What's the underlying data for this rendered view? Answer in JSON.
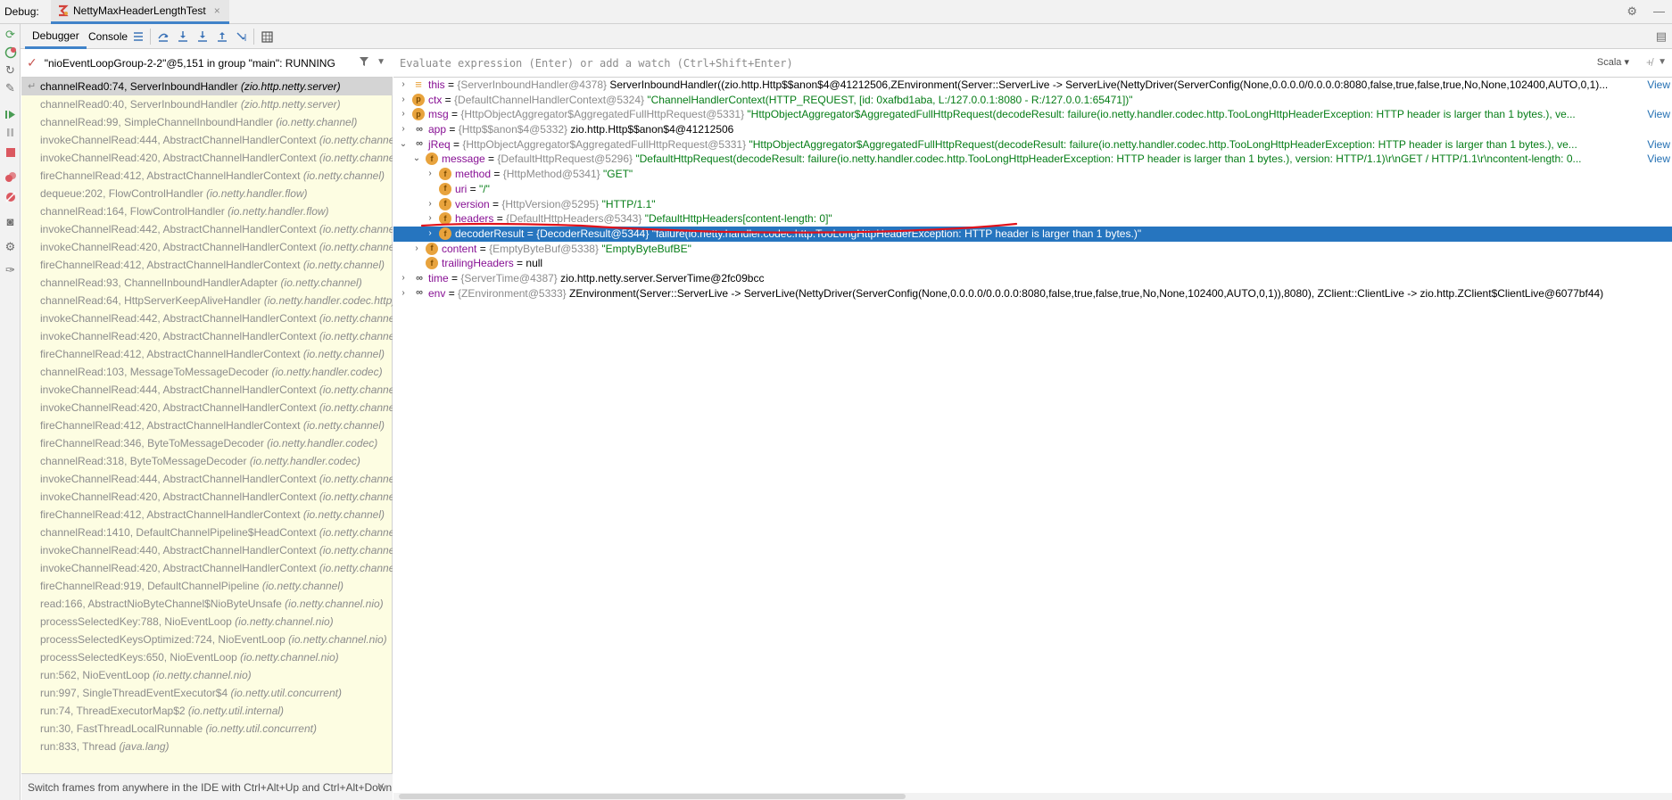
{
  "titlebar": {
    "debug_label": "Debug:",
    "session_tab": "NettyMaxHeaderLengthTest",
    "close": "×"
  },
  "toolbar": {
    "tabs": [
      {
        "label": "Debugger",
        "active": true
      },
      {
        "label": "Console",
        "active": false
      }
    ]
  },
  "thread": {
    "label": "\"nioEventLoopGroup-2-2\"@5,151 in group \"main\": RUNNING"
  },
  "frames": [
    {
      "method": "channelRead0:74, ServerInboundHandler",
      "pkg": "(zio.http.netty.server)",
      "current": true
    },
    {
      "method": "channelRead0:40, ServerInboundHandler",
      "pkg": "(zio.http.netty.server)"
    },
    {
      "method": "channelRead:99, SimpleChannelInboundHandler",
      "pkg": "(io.netty.channel)"
    },
    {
      "method": "invokeChannelRead:444, AbstractChannelHandlerContext",
      "pkg": "(io.netty.channel)"
    },
    {
      "method": "invokeChannelRead:420, AbstractChannelHandlerContext",
      "pkg": "(io.netty.channel)"
    },
    {
      "method": "fireChannelRead:412, AbstractChannelHandlerContext",
      "pkg": "(io.netty.channel)"
    },
    {
      "method": "dequeue:202, FlowControlHandler",
      "pkg": "(io.netty.handler.flow)"
    },
    {
      "method": "channelRead:164, FlowControlHandler",
      "pkg": "(io.netty.handler.flow)"
    },
    {
      "method": "invokeChannelRead:442, AbstractChannelHandlerContext",
      "pkg": "(io.netty.channel)"
    },
    {
      "method": "invokeChannelRead:420, AbstractChannelHandlerContext",
      "pkg": "(io.netty.channel)"
    },
    {
      "method": "fireChannelRead:412, AbstractChannelHandlerContext",
      "pkg": "(io.netty.channel)"
    },
    {
      "method": "channelRead:93, ChannelInboundHandlerAdapter",
      "pkg": "(io.netty.channel)"
    },
    {
      "method": "channelRead:64, HttpServerKeepAliveHandler",
      "pkg": "(io.netty.handler.codec.http)"
    },
    {
      "method": "invokeChannelRead:442, AbstractChannelHandlerContext",
      "pkg": "(io.netty.channel)"
    },
    {
      "method": "invokeChannelRead:420, AbstractChannelHandlerContext",
      "pkg": "(io.netty.channel)"
    },
    {
      "method": "fireChannelRead:412, AbstractChannelHandlerContext",
      "pkg": "(io.netty.channel)"
    },
    {
      "method": "channelRead:103, MessageToMessageDecoder",
      "pkg": "(io.netty.handler.codec)"
    },
    {
      "method": "invokeChannelRead:444, AbstractChannelHandlerContext",
      "pkg": "(io.netty.channel)"
    },
    {
      "method": "invokeChannelRead:420, AbstractChannelHandlerContext",
      "pkg": "(io.netty.channel)"
    },
    {
      "method": "fireChannelRead:412, AbstractChannelHandlerContext",
      "pkg": "(io.netty.channel)"
    },
    {
      "method": "fireChannelRead:346, ByteToMessageDecoder",
      "pkg": "(io.netty.handler.codec)"
    },
    {
      "method": "channelRead:318, ByteToMessageDecoder",
      "pkg": "(io.netty.handler.codec)"
    },
    {
      "method": "invokeChannelRead:444, AbstractChannelHandlerContext",
      "pkg": "(io.netty.channel)"
    },
    {
      "method": "invokeChannelRead:420, AbstractChannelHandlerContext",
      "pkg": "(io.netty.channel)"
    },
    {
      "method": "fireChannelRead:412, AbstractChannelHandlerContext",
      "pkg": "(io.netty.channel)"
    },
    {
      "method": "channelRead:1410, DefaultChannelPipeline$HeadContext",
      "pkg": "(io.netty.channel)"
    },
    {
      "method": "invokeChannelRead:440, AbstractChannelHandlerContext",
      "pkg": "(io.netty.channel)"
    },
    {
      "method": "invokeChannelRead:420, AbstractChannelHandlerContext",
      "pkg": "(io.netty.channel)"
    },
    {
      "method": "fireChannelRead:919, DefaultChannelPipeline",
      "pkg": "(io.netty.channel)"
    },
    {
      "method": "read:166, AbstractNioByteChannel$NioByteUnsafe",
      "pkg": "(io.netty.channel.nio)"
    },
    {
      "method": "processSelectedKey:788, NioEventLoop",
      "pkg": "(io.netty.channel.nio)"
    },
    {
      "method": "processSelectedKeysOptimized:724, NioEventLoop",
      "pkg": "(io.netty.channel.nio)"
    },
    {
      "method": "processSelectedKeys:650, NioEventLoop",
      "pkg": "(io.netty.channel.nio)"
    },
    {
      "method": "run:562, NioEventLoop",
      "pkg": "(io.netty.channel.nio)"
    },
    {
      "method": "run:997, SingleThreadEventExecutor$4",
      "pkg": "(io.netty.util.concurrent)"
    },
    {
      "method": "run:74, ThreadExecutorMap$2",
      "pkg": "(io.netty.util.internal)"
    },
    {
      "method": "run:30, FastThreadLocalRunnable",
      "pkg": "(io.netty.util.concurrent)"
    },
    {
      "method": "run:833, Thread",
      "pkg": "(java.lang)"
    }
  ],
  "tip": "Switch frames from anywhere in the IDE with Ctrl+Alt+Up and Ctrl+Alt+Down",
  "evaluate": {
    "placeholder": "Evaluate expression (Enter) or add a watch (Ctrl+Shift+Enter)",
    "language": "Scala"
  },
  "variables": [
    {
      "level": 0,
      "expand": "›",
      "icon": "eq",
      "icon_name": "this-field-icon",
      "name": "this",
      "type": "{ServerInboundHandler@4378}",
      "value": "ServerInboundHandler((zio.http.Http$$anon$4@41212506,ZEnvironment(Server::ServerLive -> ServerLive(NettyDriver(ServerConfig(None,0.0.0.0/0.0.0.0:8080,false,true,false,true,No,None,102400,AUTO,0,1)...",
      "view": "View"
    },
    {
      "level": 0,
      "expand": "›",
      "icon": "p",
      "icon_name": "parameter-icon",
      "name": "ctx",
      "type": "{DefaultChannelHandlerContext@5324}",
      "value": "\"ChannelHandlerContext(HTTP_REQUEST, [id: 0xafbd1aba, L:/127.0.0.1:8080 - R:/127.0.0.1:65471])\""
    },
    {
      "level": 0,
      "expand": "›",
      "icon": "p",
      "icon_name": "parameter-icon",
      "name": "msg",
      "type": "{HttpObjectAggregator$AggregatedFullHttpRequest@5331}",
      "value": "\"HttpObjectAggregator$AggregatedFullHttpRequest(decodeResult: failure(io.netty.handler.codec.http.TooLongHttpHeaderException: HTTP header is larger than 1 bytes.), ve...",
      "view": "View"
    },
    {
      "level": 0,
      "expand": "›",
      "icon": "oo",
      "icon_name": "local-variable-icon",
      "name": "app",
      "type": "{Http$$anon$4@5332}",
      "value": "zio.http.Http$$anon$4@41212506"
    },
    {
      "level": 0,
      "expand": "⌄",
      "icon": "oo",
      "icon_name": "local-variable-icon",
      "name": "jReq",
      "type": "{HttpObjectAggregator$AggregatedFullHttpRequest@5331}",
      "value": "\"HttpObjectAggregator$AggregatedFullHttpRequest(decodeResult: failure(io.netty.handler.codec.http.TooLongHttpHeaderException: HTTP header is larger than 1 bytes.), ve...",
      "view": "View"
    },
    {
      "level": 1,
      "expand": "⌄",
      "icon": "f",
      "icon_name": "field-icon",
      "name": "message",
      "type": "{DefaultHttpRequest@5296}",
      "value": "\"DefaultHttpRequest(decodeResult: failure(io.netty.handler.codec.http.TooLongHttpHeaderException: HTTP header is larger than 1 bytes.), version: HTTP/1.1)\\r\\nGET / HTTP/1.1\\r\\ncontent-length: 0...",
      "view": "View"
    },
    {
      "level": 2,
      "expand": "›",
      "icon": "f",
      "icon_name": "field-icon",
      "name": "method",
      "type": "{HttpMethod@5341}",
      "value": "\"GET\""
    },
    {
      "level": 2,
      "expand": "",
      "icon": "f",
      "icon_name": "field-icon",
      "name": "uri",
      "type": "",
      "value": "\"/\""
    },
    {
      "level": 2,
      "expand": "›",
      "icon": "f",
      "icon_name": "field-icon",
      "name": "version",
      "type": "{HttpVersion@5295}",
      "value": "\"HTTP/1.1\""
    },
    {
      "level": 2,
      "expand": "›",
      "icon": "f",
      "icon_name": "field-icon",
      "name": "headers",
      "type": "{DefaultHttpHeaders@5343}",
      "value": "\"DefaultHttpHeaders[content-length: 0]\""
    },
    {
      "level": 2,
      "expand": "›",
      "icon": "f",
      "icon_name": "field-icon",
      "name": "decoderResult",
      "type": "{DecoderResult@5344}",
      "value": "\"failure(io.netty.handler.codec.http.TooLongHttpHeaderException: HTTP header is larger than 1 bytes.)\"",
      "selected": true
    },
    {
      "level": 1,
      "expand": "›",
      "icon": "f",
      "icon_name": "field-icon",
      "name": "content",
      "type": "{EmptyByteBuf@5338}",
      "value": "\"EmptyByteBufBE\""
    },
    {
      "level": 1,
      "expand": "",
      "icon": "f",
      "icon_name": "field-icon",
      "name": "trailingHeaders",
      "type": "",
      "value": "null"
    },
    {
      "level": 0,
      "expand": "›",
      "icon": "oo",
      "icon_name": "local-variable-icon",
      "name": "time",
      "type": "{ServerTime@4387}",
      "value": "zio.http.netty.server.ServerTime@2fc09bcc"
    },
    {
      "level": 0,
      "expand": "›",
      "icon": "oo",
      "icon_name": "local-variable-icon",
      "name": "env",
      "type": "{ZEnvironment@5333}",
      "value": "ZEnvironment(Server::ServerLive -> ServerLive(NettyDriver(ServerConfig(None,0.0.0.0/0.0.0.0:8080,false,true,false,true,No,None,102400,AUTO,0,1)),8080), ZClient::ClientLive -> zio.http.ZClient$ClientLive@6077bf44)"
    }
  ],
  "colors": {
    "selection": "#2675bf",
    "frames_bg": "#fdfde2",
    "annotation": "#e0121b",
    "accent": "#4083c9"
  }
}
